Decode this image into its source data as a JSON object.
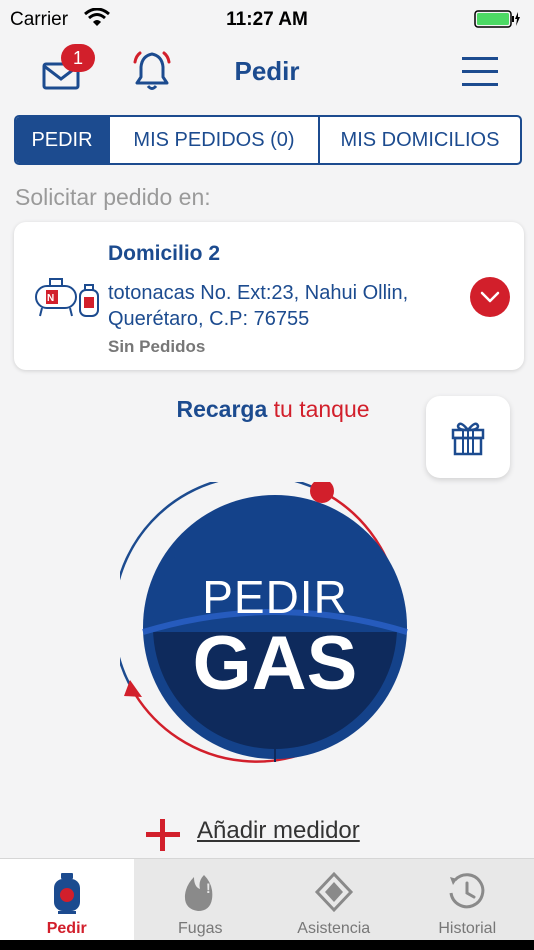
{
  "status_bar": {
    "carrier": "Carrier",
    "time": "11:27 AM"
  },
  "header": {
    "title": "Pedir",
    "mail_badge": "1"
  },
  "tabs": [
    {
      "label": "PEDIR",
      "active": true
    },
    {
      "label": "MIS PEDIDOS (0)",
      "active": false
    },
    {
      "label": "MIS DOMICILIOS",
      "active": false
    }
  ],
  "request_hint": "Solicitar pedido en:",
  "address": {
    "title": "Domicilio 2",
    "line1": "totonacas No. Ext:23, Nahui Ollin,",
    "line2": "Querétaro, C.P: 76755",
    "status": "Sin Pedidos"
  },
  "recharge": {
    "prefix": "Recarga",
    "suffix": "tu tanque"
  },
  "order_button": {
    "line1": "PEDIR",
    "line2": "GAS"
  },
  "add_meter": "Añadir medidor",
  "tab_bar": [
    {
      "label": "Pedir",
      "icon": "gas-tank-icon",
      "active": true
    },
    {
      "label": "Fugas",
      "icon": "flame-icon",
      "active": false
    },
    {
      "label": "Asistencia",
      "icon": "diamond-icon",
      "active": false
    },
    {
      "label": "Historial",
      "icon": "history-icon",
      "active": false
    }
  ],
  "colors": {
    "brand_blue": "#1c4b8f",
    "accent_red": "#d21f2b",
    "dark_navy": "#0e2a5c"
  }
}
